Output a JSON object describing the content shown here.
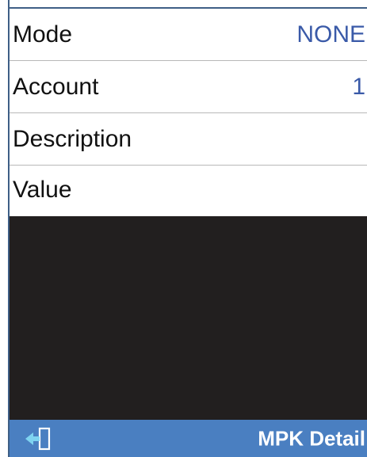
{
  "fields": [
    {
      "label": "Mode",
      "value": "NONE"
    },
    {
      "label": "Account",
      "value": "1"
    },
    {
      "label": "Description",
      "value": ""
    },
    {
      "label": "Value",
      "value": ""
    }
  ],
  "bottom_bar": {
    "title": "MPK Detail",
    "back_icon": "exit-icon"
  },
  "colors": {
    "accent": "#3a5aa8",
    "bar": "#4a7fc1",
    "dark_area": "#221f1f"
  }
}
